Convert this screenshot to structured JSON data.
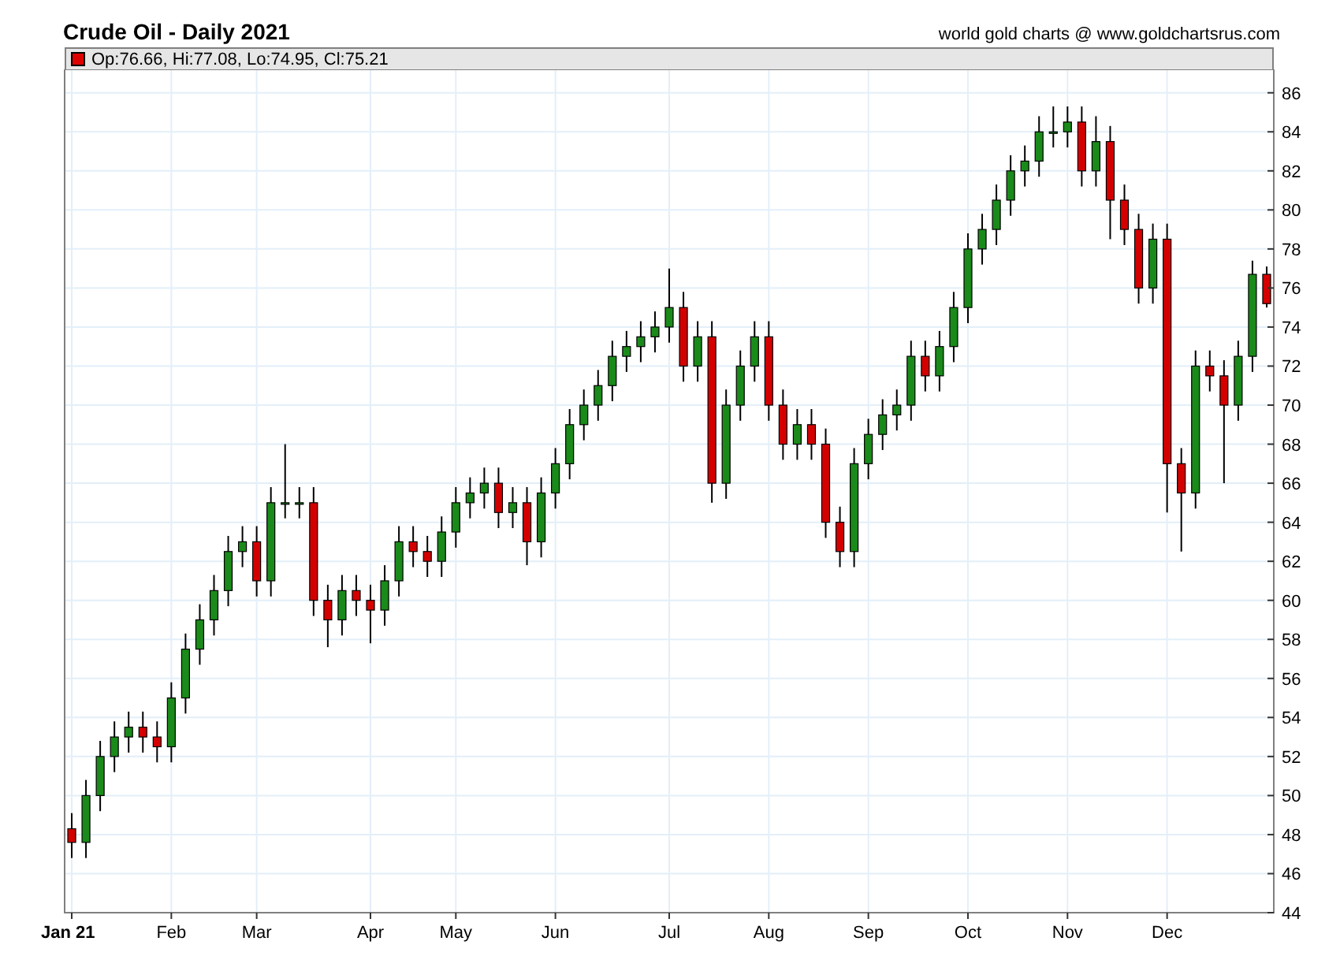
{
  "title": "Crude Oil - Daily 2021",
  "credit": "world gold charts @ www.goldchartsrus.com",
  "legend": "Op:76.66, Hi:77.08, Lo:74.95, Cl:75.21",
  "chart_data": {
    "type": "candlestick",
    "grid": true,
    "ylim": [
      44,
      87.2
    ],
    "yticks": [
      44,
      46,
      48,
      50,
      52,
      54,
      56,
      58,
      60,
      62,
      64,
      66,
      68,
      70,
      72,
      74,
      76,
      78,
      80,
      82,
      84,
      86
    ],
    "categories": [
      "Jan 21",
      null,
      null,
      null,
      null,
      null,
      null,
      "Feb",
      null,
      null,
      null,
      null,
      null,
      "Mar",
      null,
      null,
      null,
      null,
      null,
      null,
      null,
      "Apr",
      null,
      null,
      null,
      null,
      null,
      "May",
      null,
      null,
      null,
      null,
      null,
      null,
      "Jun",
      null,
      null,
      null,
      null,
      null,
      null,
      null,
      "Jul",
      null,
      null,
      null,
      null,
      null,
      null,
      "Aug",
      null,
      null,
      null,
      null,
      null,
      null,
      "Sep",
      null,
      null,
      null,
      null,
      null,
      null,
      "Oct",
      null,
      null,
      null,
      null,
      null,
      null,
      "Nov",
      null,
      null,
      null,
      null,
      null,
      null,
      "Dec",
      null,
      null,
      null,
      null,
      null,
      null,
      null
    ],
    "ohlc": [
      [
        48.3,
        49.1,
        46.8,
        47.6
      ],
      [
        47.6,
        50.8,
        46.8,
        50
      ],
      [
        50,
        52.8,
        49.2,
        52
      ],
      [
        52,
        53.8,
        51.2,
        53
      ],
      [
        53,
        54.3,
        52.2,
        53.5
      ],
      [
        53.5,
        54.3,
        52.2,
        53
      ],
      [
        53,
        53.8,
        51.7,
        52.5
      ],
      [
        52.5,
        55.8,
        51.7,
        55
      ],
      [
        55,
        58.3,
        54.2,
        57.5
      ],
      [
        57.5,
        59.8,
        56.7,
        59
      ],
      [
        59,
        61.3,
        58.2,
        60.5
      ],
      [
        60.5,
        63.3,
        59.7,
        62.5
      ],
      [
        62.5,
        63.8,
        61.7,
        63
      ],
      [
        63,
        63.8,
        60.2,
        61
      ],
      [
        61,
        65.8,
        60.2,
        65
      ],
      [
        65,
        68,
        64.2,
        65
      ],
      [
        65,
        65.8,
        64.2,
        65
      ],
      [
        65,
        65.8,
        59.2,
        60
      ],
      [
        60,
        60.8,
        57.6,
        59
      ],
      [
        59,
        61.3,
        58.2,
        60.5
      ],
      [
        60.5,
        61.3,
        59.2,
        60
      ],
      [
        60,
        60.8,
        57.8,
        59.5
      ],
      [
        59.5,
        61.8,
        58.7,
        61
      ],
      [
        61,
        63.8,
        60.2,
        63
      ],
      [
        63,
        63.8,
        61.7,
        62.5
      ],
      [
        62.5,
        63.3,
        61.2,
        62
      ],
      [
        62,
        64.3,
        61.2,
        63.5
      ],
      [
        63.5,
        65.8,
        62.7,
        65
      ],
      [
        65,
        66.3,
        64.2,
        65.5
      ],
      [
        65.5,
        66.8,
        64.7,
        66
      ],
      [
        66,
        66.8,
        63.7,
        64.5
      ],
      [
        64.5,
        65.8,
        63.7,
        65
      ],
      [
        65,
        65.8,
        61.8,
        63
      ],
      [
        63,
        66.3,
        62.2,
        65.5
      ],
      [
        65.5,
        67.8,
        64.7,
        67
      ],
      [
        67,
        69.8,
        66.2,
        69
      ],
      [
        69,
        70.8,
        68.2,
        70
      ],
      [
        70,
        71.8,
        69.2,
        71
      ],
      [
        71,
        73.3,
        70.2,
        72.5
      ],
      [
        72.5,
        73.8,
        71.7,
        73
      ],
      [
        73,
        74.3,
        72.2,
        73.5
      ],
      [
        73.5,
        74.8,
        72.7,
        74
      ],
      [
        74,
        77,
        73.2,
        75
      ],
      [
        75,
        75.8,
        71.2,
        72
      ],
      [
        72,
        74.3,
        71.2,
        73.5
      ],
      [
        73.5,
        74.3,
        65,
        66
      ],
      [
        66,
        70.8,
        65.2,
        70
      ],
      [
        70,
        72.8,
        69.2,
        72
      ],
      [
        72,
        74.3,
        71.2,
        73.5
      ],
      [
        73.5,
        74.3,
        69.2,
        70
      ],
      [
        70,
        70.8,
        67.2,
        68
      ],
      [
        68,
        69.8,
        67.2,
        69
      ],
      [
        69,
        69.8,
        67.2,
        68
      ],
      [
        68,
        68.8,
        63.2,
        64
      ],
      [
        64,
        64.8,
        61.7,
        62.5
      ],
      [
        62.5,
        67.8,
        61.7,
        67
      ],
      [
        67,
        69.3,
        66.2,
        68.5
      ],
      [
        68.5,
        70.3,
        67.7,
        69.5
      ],
      [
        69.5,
        70.8,
        68.7,
        70
      ],
      [
        70,
        73.3,
        69.2,
        72.5
      ],
      [
        72.5,
        73.3,
        70.7,
        71.5
      ],
      [
        71.5,
        73.8,
        70.7,
        73
      ],
      [
        73,
        75.8,
        72.2,
        75
      ],
      [
        75,
        78.8,
        74.2,
        78
      ],
      [
        78,
        79.8,
        77.2,
        79
      ],
      [
        79,
        81.3,
        78.2,
        80.5
      ],
      [
        80.5,
        82.8,
        79.7,
        82
      ],
      [
        82,
        83.3,
        81.2,
        82.5
      ],
      [
        82.5,
        84.8,
        81.7,
        84
      ],
      [
        84,
        85.3,
        83.2,
        84
      ],
      [
        84,
        85.3,
        83.2,
        84.5
      ],
      [
        84.5,
        85.3,
        81.2,
        82
      ],
      [
        82,
        84.8,
        81.2,
        83.5
      ],
      [
        83.5,
        84.3,
        78.5,
        80.5
      ],
      [
        80.5,
        81.3,
        78.2,
        79
      ],
      [
        79,
        79.8,
        75.2,
        76
      ],
      [
        76,
        79.3,
        75.2,
        78.5
      ],
      [
        78.5,
        79.3,
        64.5,
        67
      ],
      [
        67,
        67.8,
        62.5,
        65.5
      ],
      [
        65.5,
        72.8,
        64.7,
        72
      ],
      [
        72,
        72.8,
        70.7,
        71.5
      ],
      [
        71.5,
        72.3,
        66,
        70
      ],
      [
        70,
        73.3,
        69.2,
        72.5
      ],
      [
        72.5,
        77.4,
        71.7,
        76.7
      ],
      [
        76.7,
        77.1,
        75,
        75.2
      ]
    ]
  }
}
